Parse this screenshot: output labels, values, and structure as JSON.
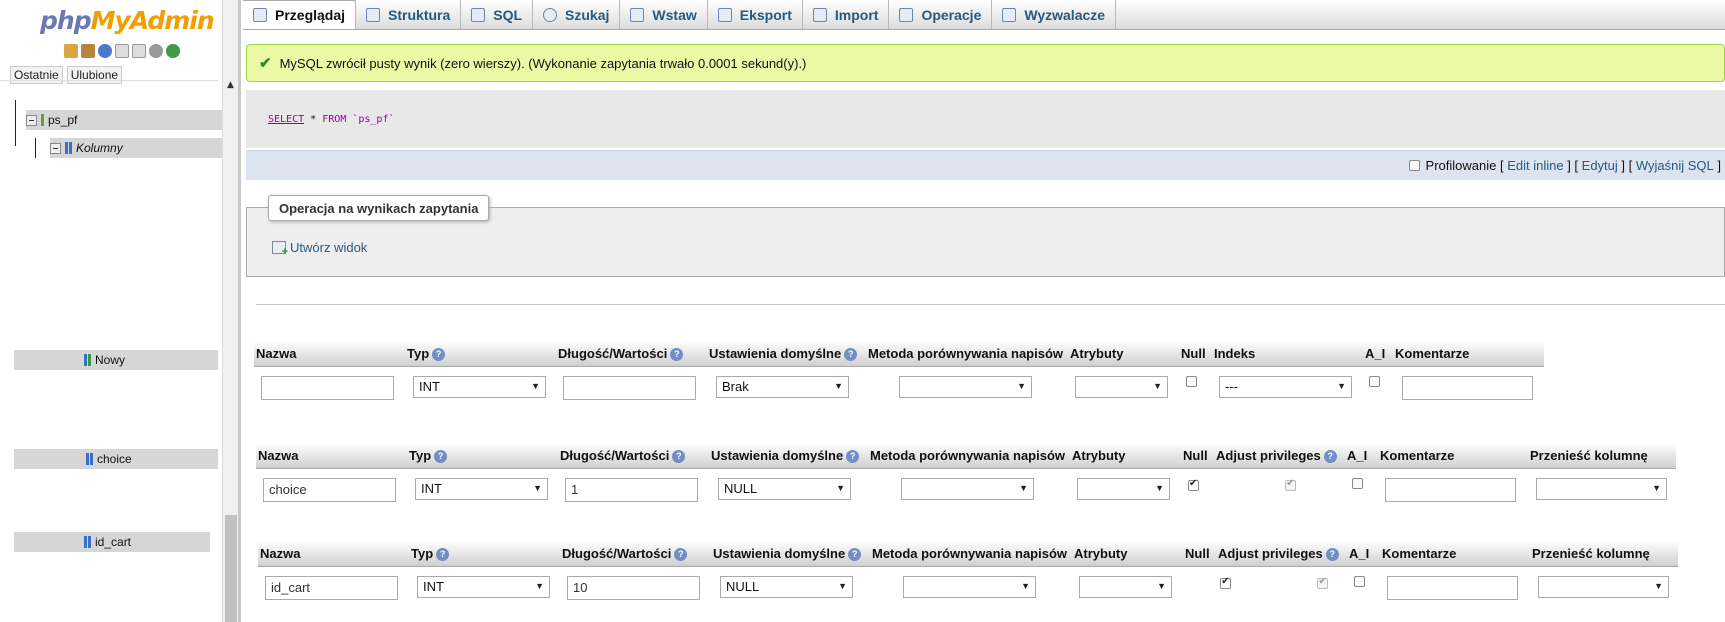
{
  "sidebar": {
    "logo": {
      "part1": "php",
      "part2": "MyAdmin"
    },
    "tabs": [
      "Ostatnie",
      "Ulubione"
    ],
    "tree": {
      "table": "ps_pf",
      "columns_group": "Kolumny",
      "items": [
        "Nowy",
        "choice",
        "id_cart"
      ]
    }
  },
  "tabs": [
    {
      "label": "Przeglądaj",
      "icon": "browse-icon",
      "active": true
    },
    {
      "label": "Struktura",
      "icon": "structure-icon"
    },
    {
      "label": "SQL",
      "icon": "sql-icon"
    },
    {
      "label": "Szukaj",
      "icon": "search-icon"
    },
    {
      "label": "Wstaw",
      "icon": "insert-icon"
    },
    {
      "label": "Eksport",
      "icon": "export-icon"
    },
    {
      "label": "Import",
      "icon": "import-icon"
    },
    {
      "label": "Operacje",
      "icon": "operations-icon"
    },
    {
      "label": "Wyzwalacze",
      "icon": "triggers-icon"
    }
  ],
  "message": "MySQL zwrócił pusty wynik (zero wierszy). (Wykonanie zapytania trwało 0.0001 sekund(y).)",
  "query": {
    "select": "SELECT",
    "star": "*",
    "from": "FROM",
    "table": "`ps_pf`"
  },
  "profiling": {
    "label": "Profilowanie",
    "links": [
      "Edit inline",
      "Edytuj",
      "Wyjaśnij SQL"
    ]
  },
  "operations": {
    "legend": "Operacja na wynikach zapytania",
    "create_view": "Utwórz widok"
  },
  "editor1": {
    "headers": [
      "Nazwa",
      "Typ",
      "Długość/Wartości",
      "Ustawienia domyślne",
      "Metoda porównywania napisów",
      "Atrybuty",
      "Null",
      "Indeks",
      "A_I",
      "Komentarze"
    ],
    "name": "",
    "type": "INT",
    "length": "",
    "default": "Brak",
    "collation": "",
    "attributes": "",
    "index": "---",
    "comment": "",
    "null": false,
    "ai": false
  },
  "editor2": {
    "headers": [
      "Nazwa",
      "Typ",
      "Długość/Wartości",
      "Ustawienia domyślne",
      "Metoda porównywania napisów",
      "Atrybuty",
      "Null",
      "Adjust privileges",
      "A_I",
      "Komentarze",
      "Przenieść kolumnę"
    ],
    "name": "choice",
    "type": "INT",
    "length": "1",
    "default": "NULL",
    "collation": "",
    "attributes": "",
    "comment": "",
    "move": "",
    "null": true,
    "adjust": true,
    "ai": false
  },
  "editor3": {
    "headers": [
      "Nazwa",
      "Typ",
      "Długość/Wartości",
      "Ustawienia domyślne",
      "Metoda porównywania napisów",
      "Atrybuty",
      "Null",
      "Adjust privileges",
      "A_I",
      "Komentarze",
      "Przenieść kolumnę"
    ],
    "name": "id_cart",
    "type": "INT",
    "length": "10",
    "default": "NULL",
    "collation": "",
    "attributes": "",
    "comment": "",
    "move": "",
    "null": true,
    "adjust": true,
    "ai": false
  }
}
